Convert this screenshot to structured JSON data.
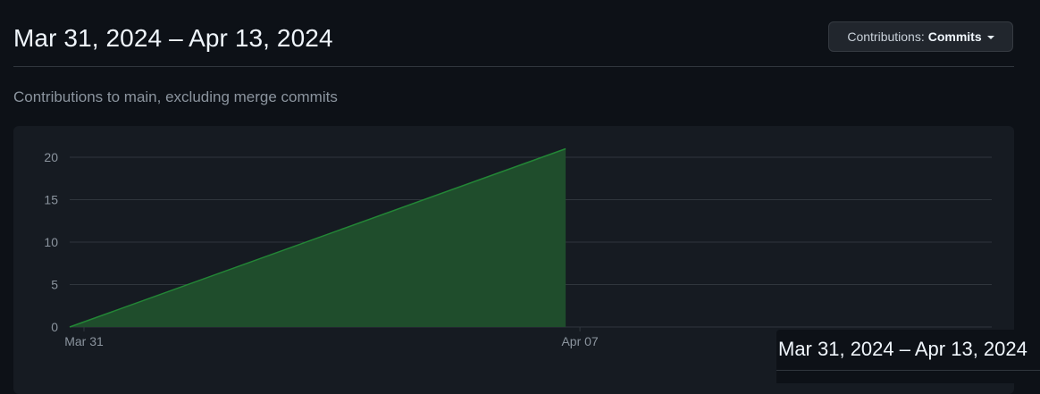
{
  "header": {
    "title": "Mar 31, 2024 – Apr 13, 2024",
    "contributions_prefix": "Contributions:",
    "contributions_value": "Commits"
  },
  "subtitle": "Contributions to main, excluding merge commits",
  "tooltip": {
    "title": "Mar 31, 2024 – Apr 13, 2024"
  },
  "colors": {
    "area_fill": "#1f4d2c",
    "area_stroke": "#238636",
    "grid": "#30363d",
    "tick_text": "#8b949e"
  },
  "chart_data": {
    "type": "area",
    "x": [
      "Mar 31",
      "Apr 07"
    ],
    "values": [
      0,
      21
    ],
    "xlabel": "",
    "ylabel": "",
    "ylim": [
      0,
      20
    ],
    "yticks": [
      0,
      5,
      10,
      15,
      20
    ],
    "xticks": [
      "Mar 31",
      "Apr 07"
    ],
    "grid": true,
    "legend": "none"
  }
}
